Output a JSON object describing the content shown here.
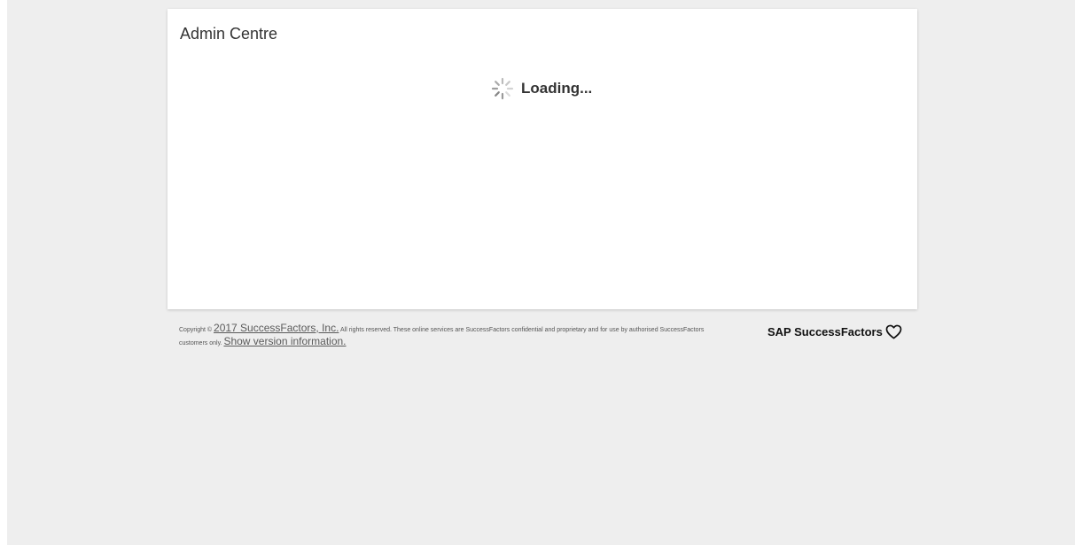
{
  "header": {
    "title": "Admin Centre"
  },
  "loading": {
    "text": "Loading..."
  },
  "footer": {
    "copyright_prefix": "Copyright ©",
    "company_link": "2017 SuccessFactors, Inc.",
    "rights_text": "All rights reserved. These online services are SuccessFactors confidential and proprietary and for use by authorised SuccessFactors customers only.",
    "version_link": "Show version information.",
    "brand": "SAP SuccessFactors"
  },
  "icons": {
    "spinner": "loading-spinner-icon",
    "heart": "heart-icon"
  },
  "colors": {
    "background": "#eeeeee",
    "panel": "#ffffff",
    "text": "#333333"
  }
}
